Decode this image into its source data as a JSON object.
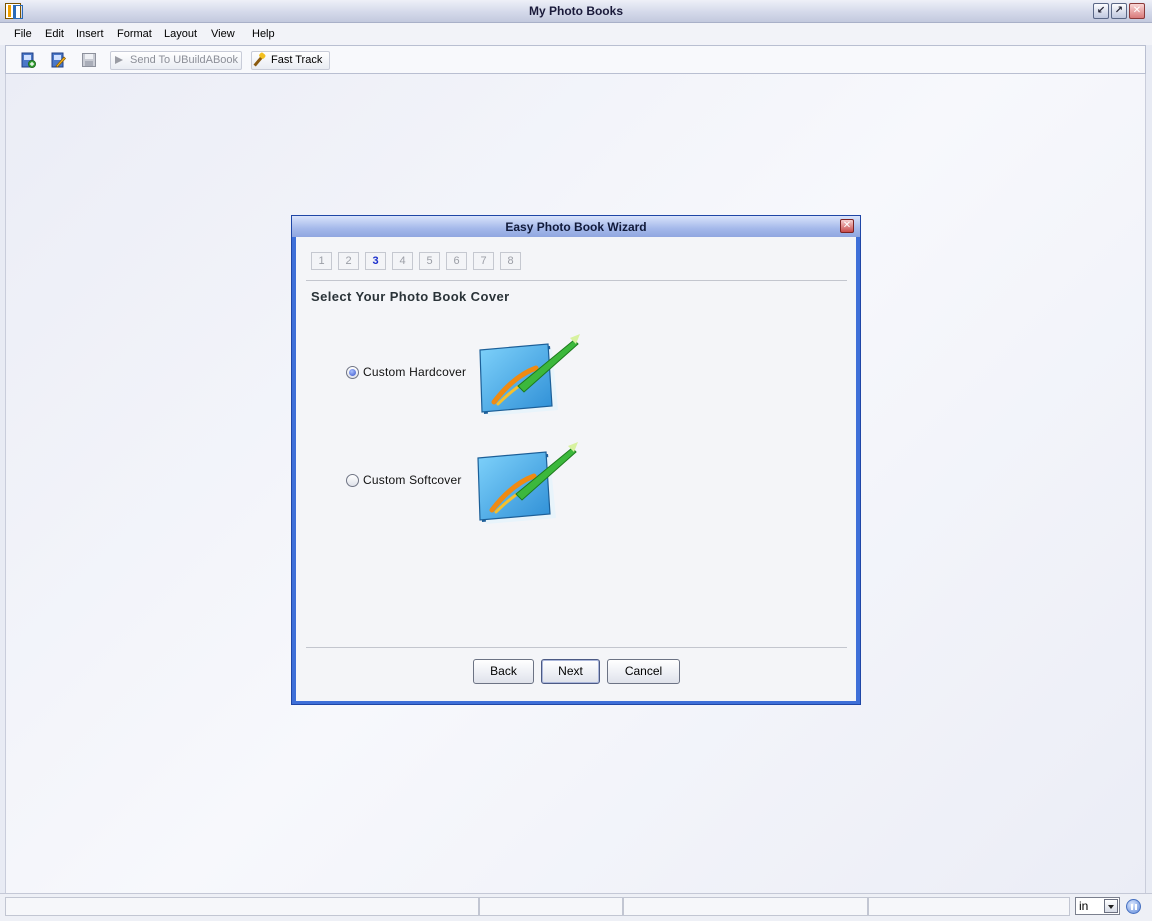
{
  "window": {
    "title": "My Photo Books"
  },
  "menu": {
    "items": [
      "File",
      "Edit",
      "Insert",
      "Format",
      "Layout",
      "View",
      "Help"
    ]
  },
  "toolbar": {
    "new_icon": "new-book-icon",
    "edit_icon": "edit-book-icon",
    "save_icon": "save-icon",
    "send_label": "Send To  UBuildABook",
    "fast_track_label": "Fast Track"
  },
  "wizard": {
    "title": "Easy Photo Book Wizard",
    "steps": [
      "1",
      "2",
      "3",
      "4",
      "5",
      "6",
      "7",
      "8"
    ],
    "active_step": "3",
    "section_title": "Select Your Photo Book Cover",
    "options": [
      {
        "label": "Custom Hardcover",
        "selected": true
      },
      {
        "label": "Custom Softcover",
        "selected": false
      }
    ],
    "buttons": {
      "back": "Back",
      "next": "Next",
      "cancel": "Cancel"
    }
  },
  "statusbar": {
    "unit": "in"
  },
  "colors": {
    "dialog_frame": "#3e6fd8",
    "active_step": "#1a2ecc",
    "book_cover": "#3aa8e6"
  }
}
